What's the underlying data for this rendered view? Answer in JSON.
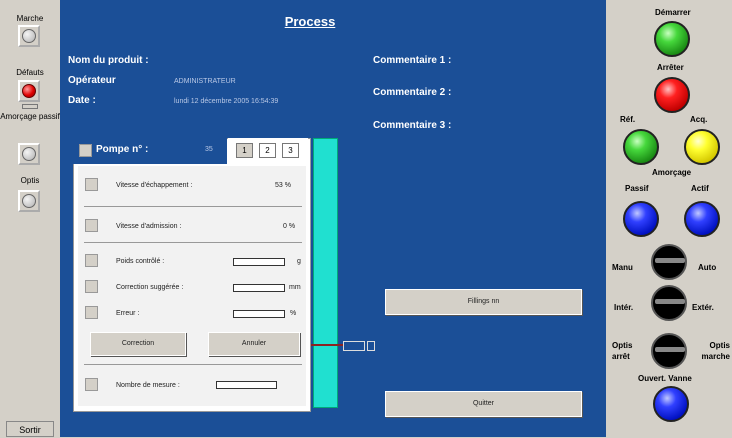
{
  "left_panel": {
    "indicators": [
      {
        "label": "Marche",
        "state": "off"
      },
      {
        "label": "Défauts",
        "state": "on"
      },
      {
        "label": "Amorçage passif",
        "state": "off"
      },
      {
        "label": "Optis",
        "state": "off"
      }
    ],
    "exit_label": "Sortir"
  },
  "main": {
    "title": "Process",
    "product_label": "Nom du produit :",
    "operator_label": "Opérateur",
    "operator_value": "ADMINISTRATEUR",
    "date_label": "Date :",
    "date_value": "lundi 12 décembre 2005 16:54:39",
    "comment1_label": "Commentaire 1 :",
    "comment2_label": "Commentaire 2 :",
    "comment3_label": "Commentaire 3 :",
    "pump_label": "Pompe n° :",
    "pump_number": "35",
    "pump_tabs": [
      "1",
      "2",
      "3"
    ],
    "exhaust_speed_label": "Vitesse d'échappement :",
    "exhaust_speed_value": "53 %",
    "intake_speed_label": "Vitesse d'admission :",
    "intake_speed_value": "0 %",
    "checked_weight_label": "Poids contrôlé :",
    "checked_weight_unit": "g",
    "suggested_correction_label": "Correction suggérée :",
    "suggested_correction_unit": "mm",
    "error_label": "Erreur :",
    "error_unit": "%",
    "correction_button": "Correction",
    "cancel_button": "Annuler",
    "measure_count_label": "Nombre de mesure :",
    "fillings_button": "Fillings nn",
    "quit_button": "Quitter"
  },
  "right_panel": {
    "start_label": "Démarrer",
    "stop_label": "Arrêter",
    "ref_label": "Réf.",
    "ack_label": "Acq.",
    "priming_label": "Amorçage",
    "passive_label": "Passif",
    "active_label": "Actif",
    "manual_label": "Manu",
    "auto_label": "Auto",
    "inner_label": "Intér.",
    "outer_label": "Extér.",
    "optis_off_label": "Optis arrêt",
    "optis_on_label": "Optis marche",
    "valve_open_label": "Ouvert. Vanne",
    "colors": {
      "start": "#2ec42a",
      "stop": "#ff1a1a",
      "ref": "#2ec42a",
      "ack": "#ffff20",
      "passive": "#1f2fff",
      "active": "#1f2fff",
      "valve": "#1f2fff"
    }
  }
}
